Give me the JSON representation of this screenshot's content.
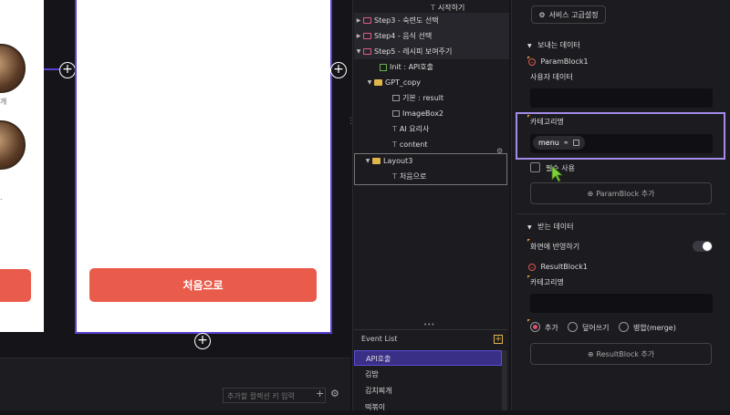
{
  "canvas": {
    "left_card_texts": [
      "개",
      "."
    ],
    "plus_symbol": "+",
    "main_button": "처음으로"
  },
  "bottom": {
    "key_input_placeholder": "추가할 컬렉션 키 입력",
    "add_symbol": "+",
    "settings_symbol": "⚙"
  },
  "tree": {
    "top_item": "시작하기",
    "rows": [
      {
        "label": "Step3 - 숙련도 선택"
      },
      {
        "label": "Step4 - 음식 선택"
      },
      {
        "label": "Step5 - 레시피 보여주기"
      },
      {
        "label": "Init : API호출"
      },
      {
        "label": "GPT_copy"
      },
      {
        "label": "기본 : result"
      },
      {
        "label": "ImageBox2"
      },
      {
        "label": "AI 요리사"
      },
      {
        "label": "content"
      },
      {
        "label": "Layout3"
      },
      {
        "label": "처음으로"
      }
    ],
    "ellipsis": "•••"
  },
  "events": {
    "header": "Event List",
    "add": "+",
    "items": [
      "API호출",
      "김밥",
      "김치찌개",
      "떡볶이"
    ]
  },
  "props": {
    "service_button": "서비스 고급설정",
    "send_section": "보내는 데이터",
    "param_block": "ParamBlock1",
    "user_data_label": "사용자 데이터",
    "category_label": "카테고리명",
    "chip_text": "menu",
    "required_label": "필수 사용",
    "add_param_button": "ParamBlock 추가",
    "receive_section": "받는 데이터",
    "reflect_label": "화면에 반영하기",
    "result_block": "ResultBlock1",
    "result_category_label": "카테고리명",
    "radio_add": "추가",
    "radio_overwrite": "덮어쓰기",
    "radio_merge": "병합(merge)",
    "add_result_button": "ResultBlock 추가"
  }
}
